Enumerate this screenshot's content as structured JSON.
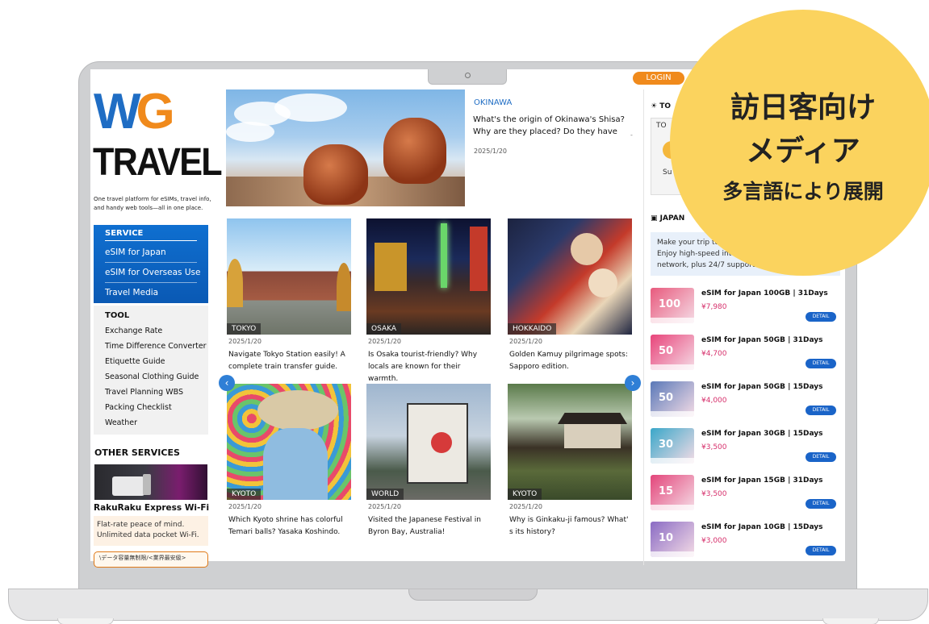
{
  "header": {
    "login_label": "LOGIN"
  },
  "brand": {
    "logo_w": "W",
    "logo_g": "G",
    "logo_word": "TRAVEL",
    "tagline": "One travel platform for eSIMs, travel info, and handy web tools—all in one place."
  },
  "sidebar": {
    "service_heading": "SERVICE",
    "service_items": [
      "eSIM for Japan",
      "eSIM for Overseas Use",
      "Travel Media"
    ],
    "tool_heading": "TOOL",
    "tool_items": [
      "Exchange Rate",
      "Time Difference Converter",
      "Etiquette Guide",
      "Seasonal Clothing Guide",
      "Travel Planning WBS",
      "Packing Checklist",
      "Weather"
    ],
    "other_heading": "OTHER SERVICES",
    "wifi_title": "RakuRaku Express Wi-Fi",
    "wifi_desc": "Flat-rate peace of mind. Unlimited data pocket Wi-Fi.",
    "banner_text": "\\データ容量無制限/<業界最安級>"
  },
  "hero": {
    "tag": "OKINAWA",
    "title": "What's the origin of Okinawa's Shisa? Why are they placed? Do they have",
    "date": "2025/1/20",
    "more": "-"
  },
  "articles": [
    {
      "tag": "TOKYO",
      "date": "2025/1/20",
      "title": "Navigate Tokyo Station easily! A complete train transfer guide."
    },
    {
      "tag": "OSAKA",
      "date": "2025/1/20",
      "title": "Is Osaka tourist-friendly? Why locals are known for their warmth."
    },
    {
      "tag": "HOKKAIDO",
      "date": "2025/1/20",
      "title": "Golden Kamuy pilgrimage spots: Sapporo edition."
    },
    {
      "tag": "KYOTO",
      "date": "2025/1/20",
      "title": "Which Kyoto shrine has colorful Temari balls? Yasaka Koshindo."
    },
    {
      "tag": "WORLD",
      "date": "2025/1/20",
      "title": "Visited the Japanese Festival in Byron Bay, Australia!"
    },
    {
      "tag": "KYOTO",
      "date": "2025/1/20",
      "title": "Why is Ginkaku-ji famous? What' s its history?"
    }
  ],
  "right": {
    "weather_heading": "TO",
    "weather_label": "TO",
    "weather_label2": "Su",
    "sim_heading": "JAPAN",
    "sim_desc": "Make your trip to\nEnjoy high-speed int\nnetwork, plus 24/7 support",
    "plans": [
      {
        "name": "eSIM for Japan 100GB | 31Days",
        "price": "¥7,980",
        "thumb": "100",
        "color": "#e85a7d"
      },
      {
        "name": "eSIM for Japan 50GB | 31Days",
        "price": "¥4,700",
        "thumb": "50",
        "color": "#e8447a"
      },
      {
        "name": "eSIM for Japan 50GB | 15Days",
        "price": "¥4,000",
        "thumb": "50",
        "color": "#5a79b8"
      },
      {
        "name": "eSIM for Japan 30GB | 15Days",
        "price": "¥3,500",
        "thumb": "30",
        "color": "#3aa7c9"
      },
      {
        "name": "eSIM for Japan 15GB | 31Days",
        "price": "¥3,500",
        "thumb": "15",
        "color": "#e3457a"
      },
      {
        "name": "eSIM for Japan 10GB | 15Days",
        "price": "¥3,000",
        "thumb": "10",
        "color": "#8a6bc4"
      }
    ],
    "detail_label": "DETAIL"
  },
  "badge": {
    "line1": "訪日客向け",
    "line2": "メディア",
    "line3": "多言語により展開"
  },
  "colors": {
    "brand_blue": "#1f6dc4",
    "brand_orange": "#f08a1c",
    "badge_yellow": "#fbd35e",
    "price_pink": "#d62f6b"
  }
}
